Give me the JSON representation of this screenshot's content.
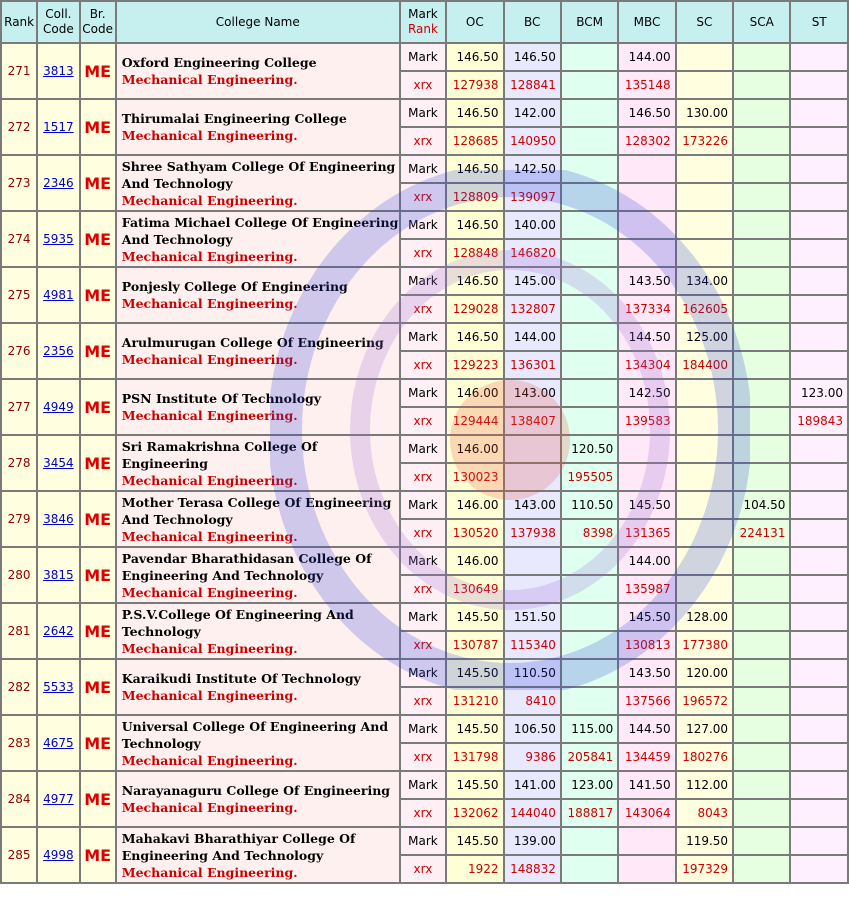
{
  "headers": {
    "rank": "Rank",
    "coll_code_1": "Coll.",
    "coll_code_2": "Code",
    "br_code_1": "Br.",
    "br_code_2": "Code",
    "college_name": "College Name",
    "mark": "Mark",
    "rank2": "Rank",
    "oc": "OC",
    "bc": "BC",
    "bcm": "BCM",
    "mbc": "MBC",
    "sc": "SC",
    "sca": "SCA",
    "st": "ST"
  },
  "row_labels": {
    "mark": "Mark",
    "rank": "xrx"
  },
  "rows": [
    {
      "rank": "271",
      "code": "3813",
      "br": "ME",
      "college": "Oxford Engineering College",
      "branch": "Mechanical Engineering.",
      "mark": {
        "oc": "146.50",
        "bc": "146.50",
        "bcm": "",
        "mbc": "144.00",
        "sc": "",
        "sca": "",
        "st": ""
      },
      "rnk": {
        "oc": "127938",
        "bc": "128841",
        "bcm": "",
        "mbc": "135148",
        "sc": "",
        "sca": "",
        "st": ""
      }
    },
    {
      "rank": "272",
      "code": "1517",
      "br": "ME",
      "college": "Thirumalai Engineering College",
      "branch": "Mechanical Engineering.",
      "mark": {
        "oc": "146.50",
        "bc": "142.00",
        "bcm": "",
        "mbc": "146.50",
        "sc": "130.00",
        "sca": "",
        "st": ""
      },
      "rnk": {
        "oc": "128685",
        "bc": "140950",
        "bcm": "",
        "mbc": "128302",
        "sc": "173226",
        "sca": "",
        "st": ""
      }
    },
    {
      "rank": "273",
      "code": "2346",
      "br": "ME",
      "college": "Shree Sathyam College Of Engineering And Technology",
      "branch": "Mechanical Engineering.",
      "mark": {
        "oc": "146.50",
        "bc": "142.50",
        "bcm": "",
        "mbc": "",
        "sc": "",
        "sca": "",
        "st": ""
      },
      "rnk": {
        "oc": "128809",
        "bc": "139097",
        "bcm": "",
        "mbc": "",
        "sc": "",
        "sca": "",
        "st": ""
      }
    },
    {
      "rank": "274",
      "code": "5935",
      "br": "ME",
      "college": "Fatima Michael College Of Engineering And Technology",
      "branch": "Mechanical Engineering.",
      "mark": {
        "oc": "146.50",
        "bc": "140.00",
        "bcm": "",
        "mbc": "",
        "sc": "",
        "sca": "",
        "st": ""
      },
      "rnk": {
        "oc": "128848",
        "bc": "146820",
        "bcm": "",
        "mbc": "",
        "sc": "",
        "sca": "",
        "st": ""
      }
    },
    {
      "rank": "275",
      "code": "4981",
      "br": "ME",
      "college": "Ponjesly College Of Engineering",
      "branch": "Mechanical Engineering.",
      "mark": {
        "oc": "146.50",
        "bc": "145.00",
        "bcm": "",
        "mbc": "143.50",
        "sc": "134.00",
        "sca": "",
        "st": ""
      },
      "rnk": {
        "oc": "129028",
        "bc": "132807",
        "bcm": "",
        "mbc": "137334",
        "sc": "162605",
        "sca": "",
        "st": ""
      }
    },
    {
      "rank": "276",
      "code": "2356",
      "br": "ME",
      "college": "Arulmurugan College Of Engineering",
      "branch": "Mechanical Engineering.",
      "mark": {
        "oc": "146.50",
        "bc": "144.00",
        "bcm": "",
        "mbc": "144.50",
        "sc": "125.00",
        "sca": "",
        "st": ""
      },
      "rnk": {
        "oc": "129223",
        "bc": "136301",
        "bcm": "",
        "mbc": "134304",
        "sc": "184400",
        "sca": "",
        "st": ""
      }
    },
    {
      "rank": "277",
      "code": "4949",
      "br": "ME",
      "college": "PSN Institute Of Technology",
      "branch": "Mechanical Engineering.",
      "mark": {
        "oc": "146.00",
        "bc": "143.00",
        "bcm": "",
        "mbc": "142.50",
        "sc": "",
        "sca": "",
        "st": "123.00"
      },
      "rnk": {
        "oc": "129444",
        "bc": "138407",
        "bcm": "",
        "mbc": "139583",
        "sc": "",
        "sca": "",
        "st": "189843"
      }
    },
    {
      "rank": "278",
      "code": "3454",
      "br": "ME",
      "college": "Sri Ramakrishna College Of Engineering",
      "branch": "Mechanical Engineering.",
      "mark": {
        "oc": "146.00",
        "bc": "",
        "bcm": "120.50",
        "mbc": "",
        "sc": "",
        "sca": "",
        "st": ""
      },
      "rnk": {
        "oc": "130023",
        "bc": "",
        "bcm": "195505",
        "mbc": "",
        "sc": "",
        "sca": "",
        "st": ""
      }
    },
    {
      "rank": "279",
      "code": "3846",
      "br": "ME",
      "college": "Mother Terasa College Of Engineering And Technology",
      "branch": "Mechanical Engineering.",
      "mark": {
        "oc": "146.00",
        "bc": "143.00",
        "bcm": "110.50",
        "mbc": "145.50",
        "sc": "",
        "sca": "104.50",
        "st": ""
      },
      "rnk": {
        "oc": "130520",
        "bc": "137938",
        "bcm": "8398",
        "mbc": "131365",
        "sc": "",
        "sca": "224131",
        "st": ""
      }
    },
    {
      "rank": "280",
      "code": "3815",
      "br": "ME",
      "college": "Pavendar Bharathidasan College Of Engineering And Technology",
      "branch": "Mechanical Engineering.",
      "mark": {
        "oc": "146.00",
        "bc": "",
        "bcm": "",
        "mbc": "144.00",
        "sc": "",
        "sca": "",
        "st": ""
      },
      "rnk": {
        "oc": "130649",
        "bc": "",
        "bcm": "",
        "mbc": "135987",
        "sc": "",
        "sca": "",
        "st": ""
      }
    },
    {
      "rank": "281",
      "code": "2642",
      "br": "ME",
      "college": "P.S.V.College Of Engineering And Technology",
      "branch": "Mechanical Engineering.",
      "mark": {
        "oc": "145.50",
        "bc": "151.50",
        "bcm": "",
        "mbc": "145.50",
        "sc": "128.00",
        "sca": "",
        "st": ""
      },
      "rnk": {
        "oc": "130787",
        "bc": "115340",
        "bcm": "",
        "mbc": "130813",
        "sc": "177380",
        "sca": "",
        "st": ""
      }
    },
    {
      "rank": "282",
      "code": "5533",
      "br": "ME",
      "college": "Karaikudi Institute Of Technology",
      "branch": "Mechanical Engineering.",
      "mark": {
        "oc": "145.50",
        "bc": "110.50",
        "bcm": "",
        "mbc": "143.50",
        "sc": "120.00",
        "sca": "",
        "st": ""
      },
      "rnk": {
        "oc": "131210",
        "bc": "8410",
        "bcm": "",
        "mbc": "137566",
        "sc": "196572",
        "sca": "",
        "st": ""
      }
    },
    {
      "rank": "283",
      "code": "4675",
      "br": "ME",
      "college": "Universal College Of Engineering And Technology",
      "branch": "Mechanical Engineering.",
      "mark": {
        "oc": "145.50",
        "bc": "106.50",
        "bcm": "115.00",
        "mbc": "144.50",
        "sc": "127.00",
        "sca": "",
        "st": ""
      },
      "rnk": {
        "oc": "131798",
        "bc": "9386",
        "bcm": "205841",
        "mbc": "134459",
        "sc": "180276",
        "sca": "",
        "st": ""
      }
    },
    {
      "rank": "284",
      "code": "4977",
      "br": "ME",
      "college": "Narayanaguru College Of Engineering",
      "branch": "Mechanical Engineering.",
      "mark": {
        "oc": "145.50",
        "bc": "141.00",
        "bcm": "123.00",
        "mbc": "141.50",
        "sc": "112.00",
        "sca": "",
        "st": ""
      },
      "rnk": {
        "oc": "132062",
        "bc": "144040",
        "bcm": "188817",
        "mbc": "143064",
        "sc": "8043",
        "sca": "",
        "st": ""
      }
    },
    {
      "rank": "285",
      "code": "4998",
      "br": "ME",
      "college": "Mahakavi Bharathiyar College Of Engineering And Technology",
      "branch": "Mechanical Engineering.",
      "mark": {
        "oc": "145.50",
        "bc": "139.00",
        "bcm": "",
        "mbc": "",
        "sc": "119.50",
        "sca": "",
        "st": ""
      },
      "rnk": {
        "oc": "1922",
        "bc": "148832",
        "bcm": "",
        "mbc": "",
        "sc": "197329",
        "sca": "",
        "st": ""
      }
    }
  ],
  "colors": {
    "header_bg": "#c6f0f0",
    "rank_text": "#8b0000",
    "branch_text": "#cc0000",
    "link": "#0000cc"
  }
}
